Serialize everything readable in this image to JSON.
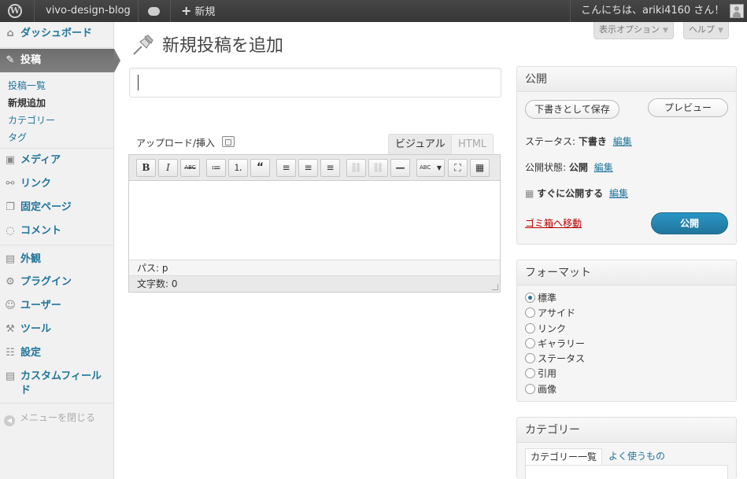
{
  "adminbar": {
    "site_name": "vivo-design-blog",
    "new_label": "新規",
    "greeting": "こんにちは、ariki4160 さん！"
  },
  "sidebar": {
    "items": [
      {
        "label": "ダッシュボード",
        "icon": "dashboard-icon"
      },
      {
        "label": "投稿",
        "icon": "pin-icon"
      },
      {
        "label": "メディア",
        "icon": "media-icon"
      },
      {
        "label": "リンク",
        "icon": "link-icon"
      },
      {
        "label": "固定ページ",
        "icon": "pages-icon"
      },
      {
        "label": "コメント",
        "icon": "comments-icon"
      },
      {
        "label": "外観",
        "icon": "appearance-icon"
      },
      {
        "label": "プラグイン",
        "icon": "plugins-icon"
      },
      {
        "label": "ユーザー",
        "icon": "users-icon"
      },
      {
        "label": "ツール",
        "icon": "tools-icon"
      },
      {
        "label": "設定",
        "icon": "settings-icon"
      },
      {
        "label": "カスタムフィールド",
        "icon": "custom-fields-icon"
      }
    ],
    "submenu": [
      "投稿一覧",
      "新規追加",
      "カテゴリー",
      "タグ"
    ],
    "collapse": "メニューを閉じる"
  },
  "screen_meta": {
    "options": "表示オプション",
    "help": "ヘルプ"
  },
  "page": {
    "title": "新規投稿を追加",
    "post_title_value": ""
  },
  "editor": {
    "upload_label": "アップロード/挿入",
    "tab_visual": "ビジュアル",
    "tab_html": "HTML",
    "path": "パス: p",
    "word_count": "文字数: 0",
    "toolbar": [
      "B",
      "I",
      "ABC",
      "≔",
      "⒈",
      "“",
      "≡",
      "≡",
      "≡",
      "⛓",
      "⛓",
      "—",
      "ABC",
      "⛶",
      "▦"
    ]
  },
  "publish": {
    "heading": "公開",
    "save_draft": "下書きとして保存",
    "preview": "プレビュー",
    "status_label": "ステータス:",
    "status_value": "下書き",
    "visibility_label": "公開状態:",
    "visibility_value": "公開",
    "schedule_value": "すぐに公開する",
    "edit_link": "編集",
    "trash": "ゴミ箱へ移動",
    "publish_button": "公開"
  },
  "format": {
    "heading": "フォーマット",
    "options": [
      "標準",
      "アサイド",
      "リンク",
      "ギャラリー",
      "ステータス",
      "引用",
      "画像"
    ],
    "selected": "標準"
  },
  "category": {
    "heading": "カテゴリー",
    "tab_all": "カテゴリー一覧",
    "tab_popular": "よく使うもの"
  },
  "colors": {
    "link": "#21759b",
    "admin_bar": "#464646",
    "publish_button": "#21759b",
    "trash": "#bb0000"
  }
}
